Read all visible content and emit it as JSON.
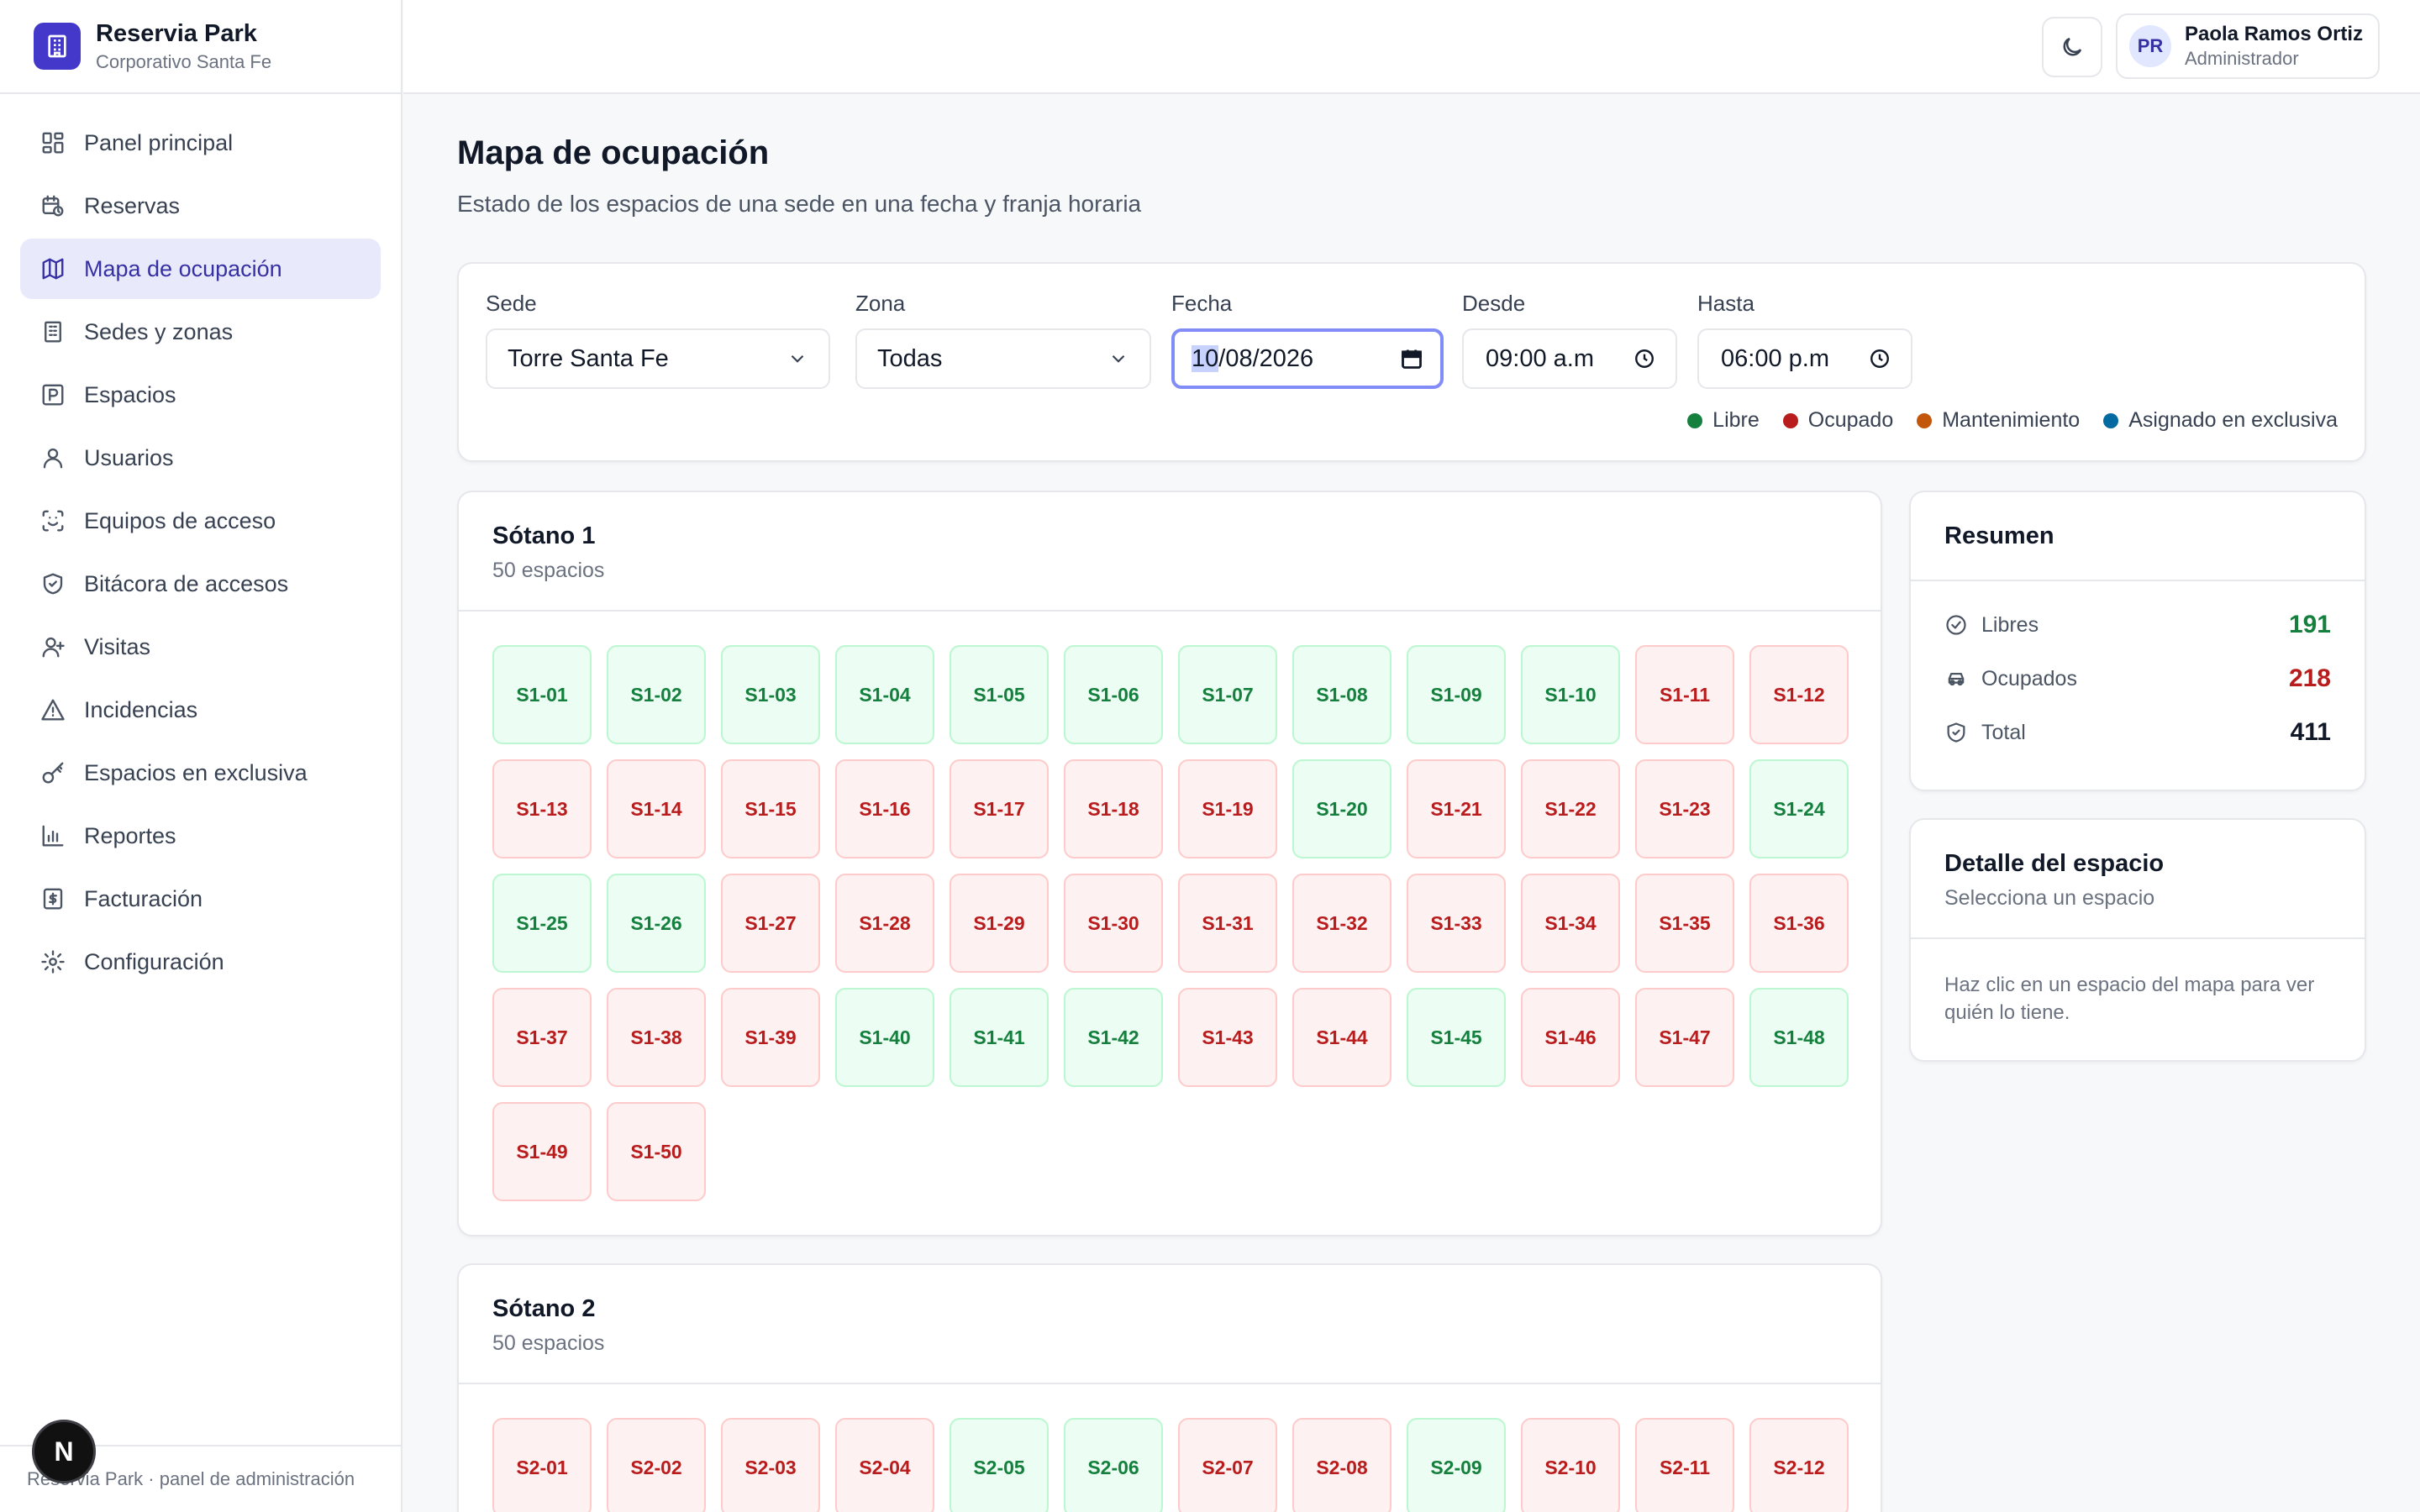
{
  "brand": {
    "name": "Reservia Park",
    "subtitle": "Corporativo Santa Fe"
  },
  "nav": [
    {
      "label": "Panel principal",
      "icon": "dashboard-icon"
    },
    {
      "label": "Reservas",
      "icon": "calendar-clock-icon"
    },
    {
      "label": "Mapa de ocupación",
      "icon": "map-icon",
      "active": true
    },
    {
      "label": "Sedes y zonas",
      "icon": "building-icon"
    },
    {
      "label": "Espacios",
      "icon": "parking-icon"
    },
    {
      "label": "Usuarios",
      "icon": "user-icon"
    },
    {
      "label": "Equipos de acceso",
      "icon": "scan-icon"
    },
    {
      "label": "Bitácora de accesos",
      "icon": "shield-icon"
    },
    {
      "label": "Visitas",
      "icon": "user-plus-icon"
    },
    {
      "label": "Incidencias",
      "icon": "warning-icon"
    },
    {
      "label": "Espacios en exclusiva",
      "icon": "key-icon"
    },
    {
      "label": "Reportes",
      "icon": "bar-chart-icon"
    },
    {
      "label": "Facturación",
      "icon": "receipt-icon"
    },
    {
      "label": "Configuración",
      "icon": "gear-icon"
    }
  ],
  "footer": "Reservia Park · panel de administración",
  "badge": "N",
  "user": {
    "initials": "PR",
    "name": "Paola Ramos Ortiz",
    "role": "Administrador"
  },
  "page": {
    "title": "Mapa de ocupación",
    "subtitle": "Estado de los espacios de una sede en una fecha y franja horaria"
  },
  "filters": {
    "sede": {
      "label": "Sede",
      "value": "Torre Santa Fe"
    },
    "zona": {
      "label": "Zona",
      "value": "Todas"
    },
    "fecha": {
      "label": "Fecha",
      "value_sel": "10",
      "value_rest": "/08/2026"
    },
    "desde": {
      "label": "Desde",
      "value": "09:00 a.m"
    },
    "hasta": {
      "label": "Hasta",
      "value": "06:00 p.m"
    }
  },
  "legend": [
    {
      "label": "Libre",
      "color": "#15803d"
    },
    {
      "label": "Ocupado",
      "color": "#b91c1c"
    },
    {
      "label": "Mantenimiento",
      "color": "#c2570c"
    },
    {
      "label": "Asignado en exclusiva",
      "color": "#0369a1"
    }
  ],
  "zones": [
    {
      "title": "Sótano 1",
      "count": "50 espacios",
      "spaces": [
        {
          "id": "S1-01",
          "status": "libre"
        },
        {
          "id": "S1-02",
          "status": "libre"
        },
        {
          "id": "S1-03",
          "status": "libre"
        },
        {
          "id": "S1-04",
          "status": "libre"
        },
        {
          "id": "S1-05",
          "status": "libre"
        },
        {
          "id": "S1-06",
          "status": "libre"
        },
        {
          "id": "S1-07",
          "status": "libre"
        },
        {
          "id": "S1-08",
          "status": "libre"
        },
        {
          "id": "S1-09",
          "status": "libre"
        },
        {
          "id": "S1-10",
          "status": "libre"
        },
        {
          "id": "S1-11",
          "status": "ocupado"
        },
        {
          "id": "S1-12",
          "status": "ocupado"
        },
        {
          "id": "S1-13",
          "status": "ocupado"
        },
        {
          "id": "S1-14",
          "status": "ocupado"
        },
        {
          "id": "S1-15",
          "status": "ocupado"
        },
        {
          "id": "S1-16",
          "status": "ocupado"
        },
        {
          "id": "S1-17",
          "status": "ocupado"
        },
        {
          "id": "S1-18",
          "status": "ocupado"
        },
        {
          "id": "S1-19",
          "status": "ocupado"
        },
        {
          "id": "S1-20",
          "status": "libre"
        },
        {
          "id": "S1-21",
          "status": "ocupado"
        },
        {
          "id": "S1-22",
          "status": "ocupado"
        },
        {
          "id": "S1-23",
          "status": "ocupado"
        },
        {
          "id": "S1-24",
          "status": "libre"
        },
        {
          "id": "S1-25",
          "status": "libre"
        },
        {
          "id": "S1-26",
          "status": "libre"
        },
        {
          "id": "S1-27",
          "status": "ocupado"
        },
        {
          "id": "S1-28",
          "status": "ocupado"
        },
        {
          "id": "S1-29",
          "status": "ocupado"
        },
        {
          "id": "S1-30",
          "status": "ocupado"
        },
        {
          "id": "S1-31",
          "status": "ocupado"
        },
        {
          "id": "S1-32",
          "status": "ocupado"
        },
        {
          "id": "S1-33",
          "status": "ocupado"
        },
        {
          "id": "S1-34",
          "status": "ocupado"
        },
        {
          "id": "S1-35",
          "status": "ocupado"
        },
        {
          "id": "S1-36",
          "status": "ocupado"
        },
        {
          "id": "S1-37",
          "status": "ocupado"
        },
        {
          "id": "S1-38",
          "status": "ocupado"
        },
        {
          "id": "S1-39",
          "status": "ocupado"
        },
        {
          "id": "S1-40",
          "status": "libre"
        },
        {
          "id": "S1-41",
          "status": "libre"
        },
        {
          "id": "S1-42",
          "status": "libre"
        },
        {
          "id": "S1-43",
          "status": "ocupado"
        },
        {
          "id": "S1-44",
          "status": "ocupado"
        },
        {
          "id": "S1-45",
          "status": "libre"
        },
        {
          "id": "S1-46",
          "status": "ocupado"
        },
        {
          "id": "S1-47",
          "status": "ocupado"
        },
        {
          "id": "S1-48",
          "status": "libre"
        },
        {
          "id": "S1-49",
          "status": "ocupado"
        },
        {
          "id": "S1-50",
          "status": "ocupado"
        }
      ]
    },
    {
      "title": "Sótano 2",
      "count": "50 espacios",
      "spaces": [
        {
          "id": "S2-01",
          "status": "ocupado"
        },
        {
          "id": "S2-02",
          "status": "ocupado"
        },
        {
          "id": "S2-03",
          "status": "ocupado"
        },
        {
          "id": "S2-04",
          "status": "ocupado"
        },
        {
          "id": "S2-05",
          "status": "libre"
        },
        {
          "id": "S2-06",
          "status": "libre"
        },
        {
          "id": "S2-07",
          "status": "ocupado"
        },
        {
          "id": "S2-08",
          "status": "ocupado"
        },
        {
          "id": "S2-09",
          "status": "libre"
        },
        {
          "id": "S2-10",
          "status": "ocupado"
        },
        {
          "id": "S2-11",
          "status": "ocupado"
        },
        {
          "id": "S2-12",
          "status": "ocupado"
        }
      ]
    }
  ],
  "summary": {
    "title": "Resumen",
    "rows": [
      {
        "label": "Libres",
        "value": "191",
        "color": "#15803d",
        "icon": "check-circle-icon"
      },
      {
        "label": "Ocupados",
        "value": "218",
        "color": "#b91c1c",
        "icon": "car-icon"
      },
      {
        "label": "Total",
        "value": "411",
        "color": "#111827",
        "icon": "shield-icon"
      }
    ]
  },
  "detail": {
    "title": "Detalle del espacio",
    "subtitle": "Selecciona un espacio",
    "body": "Haz clic en un espacio del mapa para ver quién lo tiene."
  }
}
